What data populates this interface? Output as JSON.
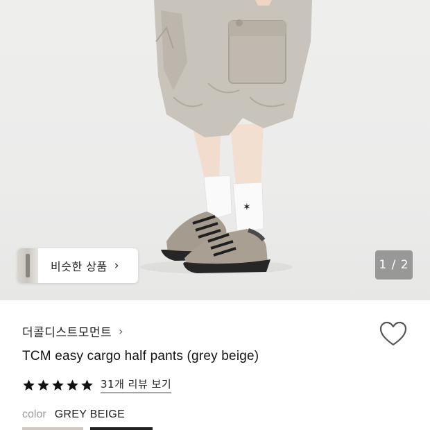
{
  "gallery": {
    "similar_products_label": "비슷한 상품",
    "similar_chevron": "›",
    "counter": "1 / 2"
  },
  "product": {
    "brand": "더콜디스트모먼트",
    "brand_chevron": "›",
    "title": "TCM easy cargo half pants (grey beige)",
    "rating_stars": 5,
    "review_link": "31개 리뷰 보기",
    "color_label": "color",
    "color_value": "GREY BEIGE"
  },
  "colors": {
    "star": "#111111",
    "heart_stroke": "#555555",
    "pants": "#c9c4bb",
    "shoe": "#a59b8f"
  },
  "icons": {
    "wishlist": "heart-outline-icon",
    "star": "star-icon"
  }
}
